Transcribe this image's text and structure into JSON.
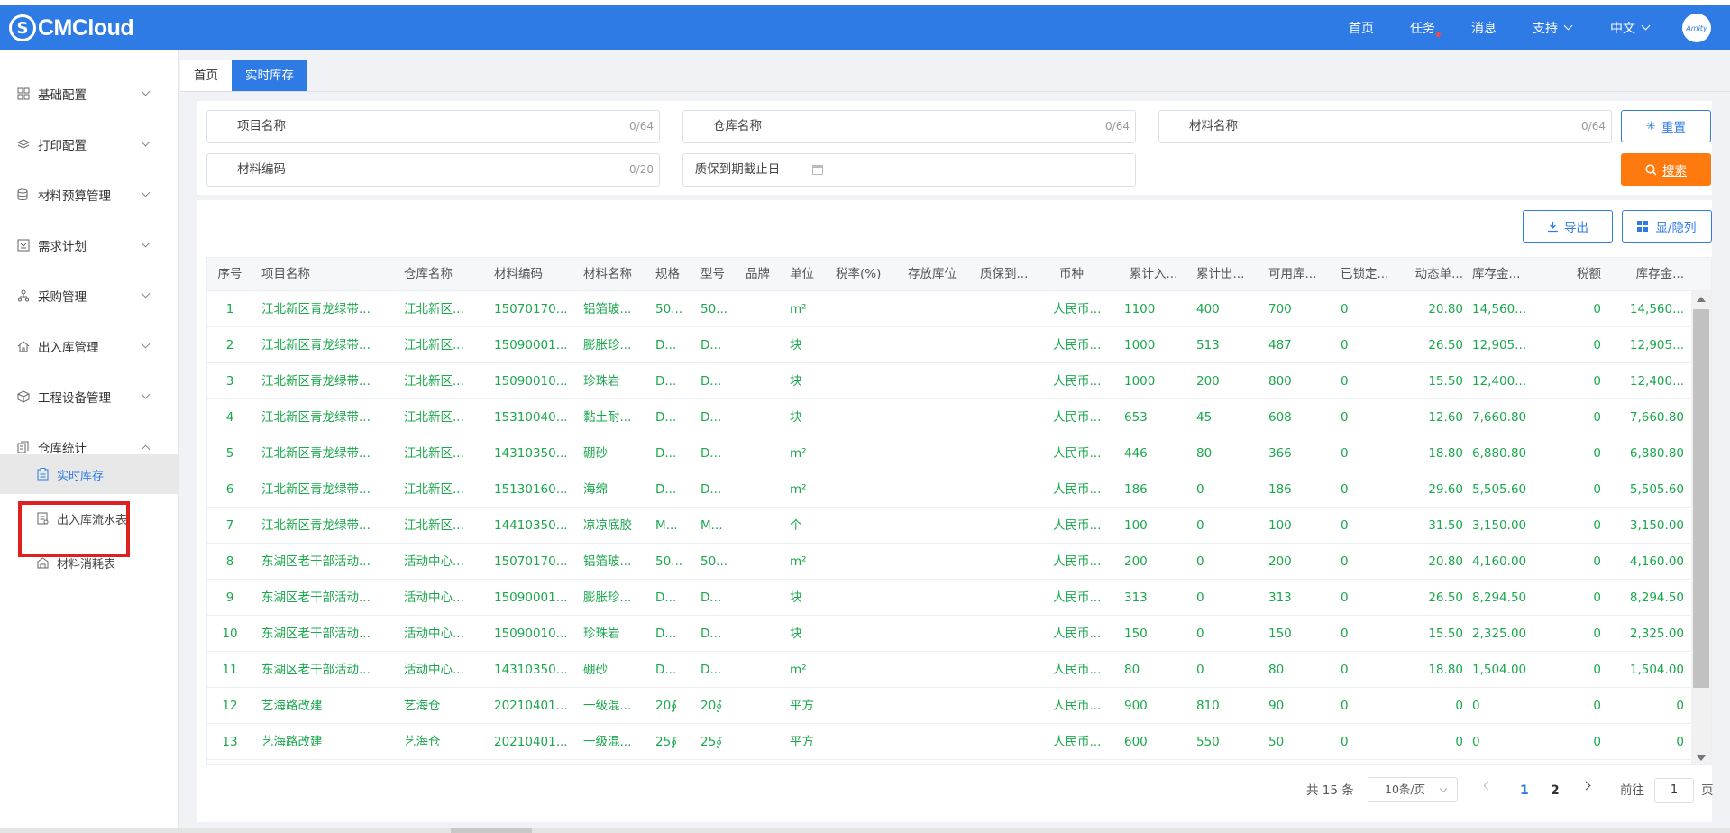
{
  "header": {
    "logo_text": "CMCloud",
    "nav": {
      "home": "首页",
      "tasks": "任务",
      "messages": "消息",
      "support": "支持",
      "language": "中文"
    },
    "accent": "#2e7be6"
  },
  "sidebar": {
    "items": [
      {
        "label": "基础配置",
        "icon": "grid-icon"
      },
      {
        "label": "打印配置",
        "icon": "layers-icon"
      },
      {
        "label": "材料预算管理",
        "icon": "database-icon"
      },
      {
        "label": "需求计划",
        "icon": "document-icon"
      },
      {
        "label": "采购管理",
        "icon": "org-chart-icon"
      },
      {
        "label": "出入库管理",
        "icon": "home-icon"
      },
      {
        "label": "工程设备管理",
        "icon": "cube-icon"
      },
      {
        "label": "仓库统计",
        "icon": "stack-icon"
      }
    ],
    "subitems": [
      {
        "label": "实时库存",
        "active": true
      },
      {
        "label": "出入库流水表",
        "active": false
      },
      {
        "label": "材料消耗表",
        "active": false
      }
    ]
  },
  "tabs": [
    {
      "label": "首页",
      "active": false
    },
    {
      "label": "实时库存",
      "active": true
    }
  ],
  "filters": {
    "project_name": {
      "label": "项目名称",
      "count": "0/64"
    },
    "warehouse_name": {
      "label": "仓库名称",
      "count": "0/64"
    },
    "material_name": {
      "label": "材料名称",
      "count": "0/64"
    },
    "material_code": {
      "label": "材料编码",
      "count": "0/20"
    },
    "warranty_deadline": {
      "label": "质保到期截止日"
    },
    "reset_label": "重置",
    "search_label": "搜索"
  },
  "toolbar": {
    "export_label": "导出",
    "columns_label": "显/隐列"
  },
  "table": {
    "columns": [
      "序号",
      "项目名称",
      "仓库名称",
      "材料编码",
      "材料名称",
      "规格",
      "型号",
      "品牌",
      "单位",
      "税率(%)",
      "存放库位",
      "质保到...",
      "币种",
      "累计入...",
      "累计出...",
      "可用库...",
      "已锁定...",
      "动态单...",
      "库存金...",
      "税额",
      "库存金..."
    ],
    "rows": [
      [
        "1",
        "江北新区青龙绿带...",
        "江北新区...",
        "15070170...",
        "铝箔玻...",
        "50...",
        "50...",
        "",
        "m²",
        "",
        "",
        "",
        "人民币...",
        "1100",
        "400",
        "700",
        "0",
        "20.80",
        "14,560...",
        "0",
        "14,560..."
      ],
      [
        "2",
        "江北新区青龙绿带...",
        "江北新区...",
        "15090001...",
        "膨胀珍...",
        "D...",
        "D...",
        "",
        "块",
        "",
        "",
        "",
        "人民币...",
        "1000",
        "513",
        "487",
        "0",
        "26.50",
        "12,905...",
        "0",
        "12,905..."
      ],
      [
        "3",
        "江北新区青龙绿带...",
        "江北新区...",
        "15090010...",
        "珍珠岩",
        "D...",
        "D...",
        "",
        "块",
        "",
        "",
        "",
        "人民币...",
        "1000",
        "200",
        "800",
        "0",
        "15.50",
        "12,400...",
        "0",
        "12,400..."
      ],
      [
        "4",
        "江北新区青龙绿带...",
        "江北新区...",
        "15310040...",
        "黏土耐...",
        "D...",
        "D...",
        "",
        "块",
        "",
        "",
        "",
        "人民币...",
        "653",
        "45",
        "608",
        "0",
        "12.60",
        "7,660.80",
        "0",
        "7,660.80"
      ],
      [
        "5",
        "江北新区青龙绿带...",
        "江北新区...",
        "14310350...",
        "硼砂",
        "D...",
        "D...",
        "",
        "m²",
        "",
        "",
        "",
        "人民币...",
        "446",
        "80",
        "366",
        "0",
        "18.80",
        "6,880.80",
        "0",
        "6,880.80"
      ],
      [
        "6",
        "江北新区青龙绿带...",
        "江北新区...",
        "15130160...",
        "海绵",
        "D...",
        "D...",
        "",
        "m²",
        "",
        "",
        "",
        "人民币...",
        "186",
        "0",
        "186",
        "0",
        "29.60",
        "5,505.60",
        "0",
        "5,505.60"
      ],
      [
        "7",
        "江北新区青龙绿带...",
        "江北新区...",
        "14410350...",
        "凉凉底胶",
        "M...",
        "M...",
        "",
        "个",
        "",
        "",
        "",
        "人民币...",
        "100",
        "0",
        "100",
        "0",
        "31.50",
        "3,150.00",
        "0",
        "3,150.00"
      ],
      [
        "8",
        "东湖区老干部活动...",
        "活动中心...",
        "15070170...",
        "铝箔玻...",
        "50...",
        "50...",
        "",
        "m²",
        "",
        "",
        "",
        "人民币...",
        "200",
        "0",
        "200",
        "0",
        "20.80",
        "4,160.00",
        "0",
        "4,160.00"
      ],
      [
        "9",
        "东湖区老干部活动...",
        "活动中心...",
        "15090001...",
        "膨胀珍...",
        "D...",
        "D...",
        "",
        "块",
        "",
        "",
        "",
        "人民币...",
        "313",
        "0",
        "313",
        "0",
        "26.50",
        "8,294.50",
        "0",
        "8,294.50"
      ],
      [
        "10",
        "东湖区老干部活动...",
        "活动中心...",
        "15090010...",
        "珍珠岩",
        "D...",
        "D...",
        "",
        "块",
        "",
        "",
        "",
        "人民币...",
        "150",
        "0",
        "150",
        "0",
        "15.50",
        "2,325.00",
        "0",
        "2,325.00"
      ],
      [
        "11",
        "东湖区老干部活动...",
        "活动中心...",
        "14310350...",
        "硼砂",
        "D...",
        "D...",
        "",
        "m²",
        "",
        "",
        "",
        "人民币...",
        "80",
        "0",
        "80",
        "0",
        "18.80",
        "1,504.00",
        "0",
        "1,504.00"
      ],
      [
        "12",
        "艺海路改建",
        "艺海仓",
        "20210401...",
        "一级混...",
        "20∮",
        "20∮",
        "",
        "平方",
        "",
        "",
        "",
        "人民币...",
        "900",
        "810",
        "90",
        "0",
        "0",
        "0",
        "0",
        "0"
      ],
      [
        "13",
        "艺海路改建",
        "艺海仓",
        "20210401...",
        "一级混...",
        "25∮",
        "25∮",
        "",
        "平方",
        "",
        "",
        "",
        "人民币...",
        "600",
        "550",
        "50",
        "0",
        "0",
        "0",
        "0",
        "0"
      ]
    ],
    "row_text_color": "#1aa84c"
  },
  "pagination": {
    "total": "共 15 条",
    "page_size": "10条/页",
    "pages": [
      "1",
      "2"
    ],
    "current": "1",
    "goto_label": "前往",
    "goto_value": "1",
    "page_suffix": "页"
  }
}
